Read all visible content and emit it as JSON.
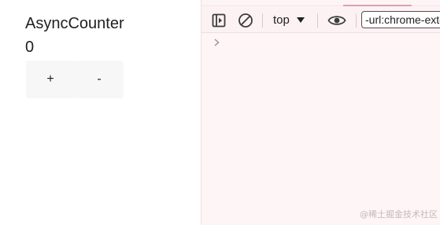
{
  "app": {
    "title": "AsyncCounter",
    "count": "0",
    "increment_label": "+",
    "decrement_label": "-"
  },
  "devtools": {
    "context": "top",
    "filter_value": "-url:chrome-extension",
    "watermark": "@稀土掘金技术社区",
    "colors": {
      "panel_background": "#fdf5f6",
      "toolbar_background": "#fcf2f4",
      "active_tab_indicator": "#d8a3ad"
    },
    "icons": {
      "sidebar_toggle": "sidebar-toggle-icon",
      "clear_console": "clear-console-icon",
      "context_caret": "caret-down-icon",
      "live_expression": "eye-icon",
      "prompt": "chevron-right-icon"
    }
  }
}
